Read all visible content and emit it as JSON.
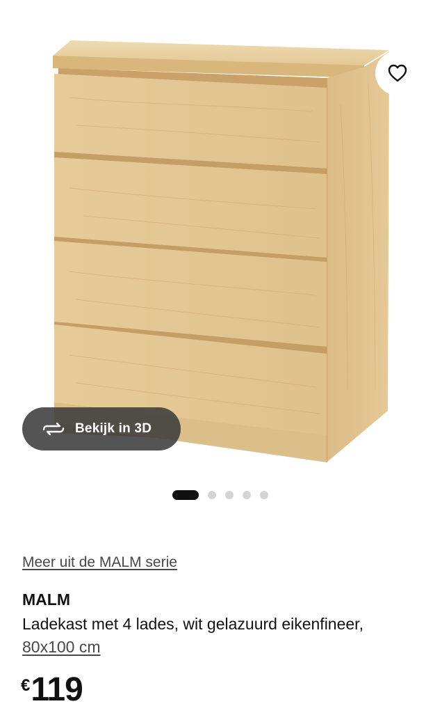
{
  "product_image": {
    "icon": "malm-dresser-image",
    "colors": {
      "wood_light": "#e9cf9f",
      "wood_mid": "#dcbb86",
      "wood_dark": "#c49c63"
    }
  },
  "wishlist": {
    "icon": "heart-icon"
  },
  "view_3d": {
    "icon": "rotate-3d-icon",
    "label": "Bekijk in 3D"
  },
  "carousel": {
    "total": 5,
    "active_index": 0
  },
  "series_link": {
    "label": "Meer uit de MALM serie"
  },
  "product": {
    "name": "MALM",
    "description": "Ladekast met 4 lades, wit gelazuurd eikenfineer,",
    "size": "80x100 cm"
  },
  "price": {
    "currency": "€",
    "amount": "119"
  }
}
